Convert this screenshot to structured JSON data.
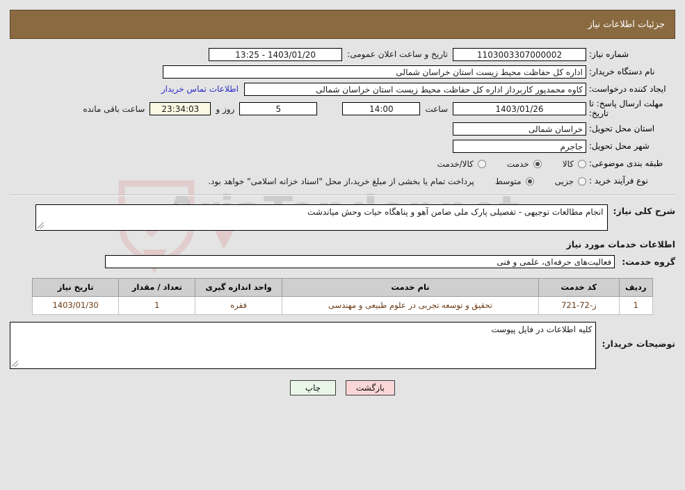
{
  "header": {
    "title": "جزئیات اطلاعات نیاز"
  },
  "form": {
    "need_number_label": "شماره نیاز:",
    "need_number_value": "1103003307000002",
    "announce_label": "تاریخ و ساعت اعلان عمومی:",
    "announce_value": "1403/01/20 - 13:25",
    "buyer_org_label": "نام دستگاه خریدار:",
    "buyer_org_value": "اداره کل حفاظت محیط زیست استان خراسان شمالی",
    "creator_label": "ایجاد کننده درخواست:",
    "creator_value": "کاوه  محمدپور  کاربرداز اداره کل حفاظت محیط زیست استان خراسان شمالی",
    "contact_link": "اطلاعات تماس خریدار",
    "deadline_label": "مهلت ارسال پاسخ: تا تاریخ:",
    "deadline_date": "1403/01/26",
    "hour_label": "ساعت",
    "deadline_time": "14:00",
    "days_value": "5",
    "days_label": "روز و",
    "countdown_value": "23:34:03",
    "remaining_label": "ساعت باقی مانده",
    "province_label": "استان محل تحویل:",
    "province_value": "خراسان شمالی",
    "city_label": "شهر محل تحویل:",
    "city_value": "جاجرم",
    "category_label": "طبقه بندی موضوعی:",
    "category_options": [
      {
        "label": "کالا",
        "selected": false
      },
      {
        "label": "خدمت",
        "selected": true
      },
      {
        "label": "کالا/خدمت",
        "selected": false
      }
    ],
    "process_label": "نوع فرآیند خرید :",
    "process_options": [
      {
        "label": "جزیی",
        "selected": false
      },
      {
        "label": "متوسط",
        "selected": true
      }
    ],
    "payment_note": "پرداخت تمام یا بخشی از مبلغ خرید،از محل \"اسناد خزانه اسلامی\" خواهد بود."
  },
  "description": {
    "label": "شرح کلی نیاز:",
    "value": "انجام مطالعات توجیهی - تفصیلی پارک ملی ضامن آهو و پناهگاه حیات وحش میاندشت"
  },
  "services": {
    "section_title": "اطلاعات خدمات مورد نیاز",
    "group_label": "گروه خدمت:",
    "group_value": "فعالیت‌های حرفه‌ای، علمی و فنی",
    "table": {
      "headers": [
        "ردیف",
        "کد خدمت",
        "نام خدمت",
        "واحد اندازه گیری",
        "تعداد / مقدار",
        "تاریخ نیاز"
      ],
      "rows": [
        {
          "row": "1",
          "code": "ز-72-721",
          "name": "تحقیق و توسعه تجربی در علوم طبیعی و مهندسی",
          "unit": "فقره",
          "qty": "1",
          "date": "1403/01/30"
        }
      ]
    }
  },
  "buyer_notes": {
    "label": "توضیحات خریدار:",
    "value": "کلیه اطلاعات در فایل پیوست"
  },
  "footer": {
    "print_label": "چاپ",
    "back_label": "بازگشت"
  },
  "watermark": {
    "text": "AriaTender.net"
  }
}
